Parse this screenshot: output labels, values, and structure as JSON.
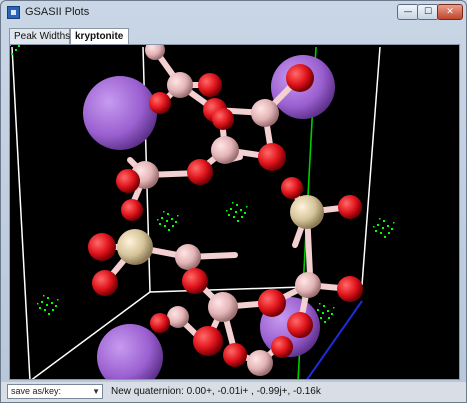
{
  "window": {
    "title": "GSASII Plots",
    "controls": {
      "minimize": "—",
      "maximize": "☐",
      "close": "✕"
    }
  },
  "tabs": [
    {
      "label": "Peak Widths",
      "selected": false
    },
    {
      "label": "kryptonite",
      "selected": true
    }
  ],
  "status": {
    "save_select_value": "save as/key:",
    "message": "New quaternion: 0.00+, -0.01i+ , -0.99j+, -0.16k"
  },
  "colors": {
    "background": "#000000",
    "cell_edges": "#ffffff",
    "axis_a": "#00cc00",
    "axis_b": "#1f2bd9",
    "oxygen": "#e0141b",
    "silicon_or_al": "#d6c49a",
    "cation_large": "#9a5fd0",
    "minor_atom": "#e3b4b6",
    "fourier_map": "#00ff00"
  }
}
